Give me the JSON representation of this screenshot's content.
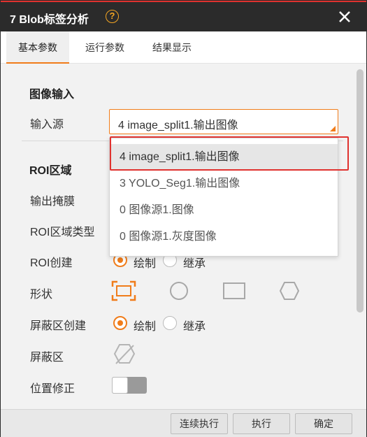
{
  "window": {
    "title": "7 Blob标签分析"
  },
  "tabs": [
    {
      "label": "基本参数",
      "active": true
    },
    {
      "label": "运行参数",
      "active": false
    },
    {
      "label": "结果显示",
      "active": false
    }
  ],
  "image_input": {
    "section_title": "图像输入",
    "source_label": "输入源",
    "source_value": "4 image_split1.输出图像"
  },
  "roi": {
    "section_title": "ROI区域",
    "output_mask_label": "输出掩膜",
    "roi_type_label": "ROI区域类型",
    "roi_create_label": "ROI创建",
    "roi_create_options": [
      "绘制",
      "继承"
    ],
    "shape_label": "形状",
    "shapes": [
      "rectangle-select-icon",
      "circle-icon",
      "rectangle-icon",
      "hexagon-icon"
    ],
    "mask_create_label": "屏蔽区创建",
    "mask_create_options": [
      "绘制",
      "继承"
    ],
    "mask_label": "屏蔽区",
    "position_fix_label": "位置修正"
  },
  "dropdown": {
    "options": [
      "4 image_split1.输出图像",
      "3 YOLO_Seg1.输出图像",
      "0 图像源1.图像",
      "0 图像源1.灰度图像"
    ],
    "selected_index": 0
  },
  "footer": {
    "continuous_run": "连续执行",
    "run": "执行",
    "ok": "确定"
  },
  "colors": {
    "accent": "#f07c1a",
    "titlebar": "#2b2b2b",
    "highlight": "#e0322f"
  }
}
